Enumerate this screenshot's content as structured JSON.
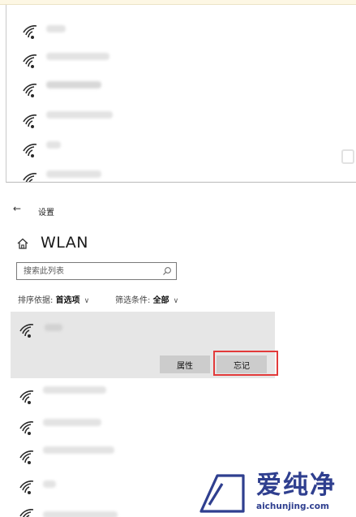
{
  "settings": {
    "window_title": "设置",
    "page_title": "WLAN"
  },
  "search": {
    "placeholder": "搜索此列表"
  },
  "filters": {
    "sort_label": "排序依据: ",
    "sort_value": "首选项",
    "screen_label": "筛选条件: ",
    "screen_value": "全部"
  },
  "selected_network": {
    "properties_label": "属性",
    "forget_label": "忘记"
  },
  "icons": {
    "back": "back-arrow-icon",
    "home": "home-icon",
    "search": "search-icon",
    "wifi": "wifi-signal-icon",
    "chevron": "chevron-down-icon"
  },
  "colors": {
    "highlight": "#e23a3a",
    "selected_bg": "#e6e6e6",
    "button_bg": "#cccccc",
    "logo": "#2f3f8f"
  },
  "watermark": {
    "brand": "爱纯净",
    "url": "aichunjing.com"
  }
}
